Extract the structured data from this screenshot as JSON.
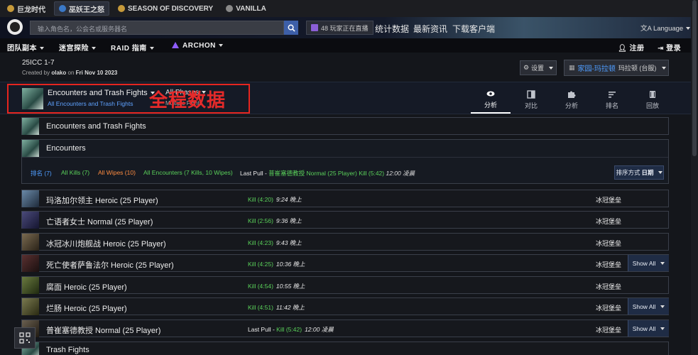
{
  "gamebar": {
    "items": [
      {
        "label": "巨龙时代",
        "active": false
      },
      {
        "label": "巫妖王之怒",
        "active": true
      },
      {
        "label": "SEASON OF DISCOVERY",
        "active": false
      },
      {
        "label": "VANILLA",
        "active": false
      }
    ]
  },
  "header": {
    "search_placeholder": "输入角色名，公会名或服务器名",
    "live_label": "48 玩家正在直播",
    "links": [
      "统计数据",
      "最新资讯",
      "下载客户端"
    ],
    "language_label": "Language"
  },
  "nav": {
    "items": [
      "团队副本",
      "迷宫探险",
      "RAID 指南",
      "ARCHON"
    ],
    "register": "注册",
    "login": "登录"
  },
  "report": {
    "title": "25ICC 1-7",
    "created_by_prefix": "Created by",
    "author": "olako",
    "on": "on",
    "date": "Fri Nov 10 2023"
  },
  "controls": {
    "settings_label": "设置",
    "guild_name": "家园-玛拉顿",
    "guild_server": "玛拉顿 (台服)"
  },
  "toolbar": {
    "fight_title": "Encounters and Trash Fights",
    "fight_sub": "All Encounters and Trash Fights",
    "phase_title": "All Phases",
    "phase_sub": "Multiple Fights",
    "annotation": "全程数据",
    "tabs": [
      {
        "label": "分析",
        "icon": "eye-icon",
        "active": true
      },
      {
        "label": "对比",
        "icon": "compare-icon",
        "active": false
      },
      {
        "label": "分析",
        "icon": "puzzle-icon",
        "active": false
      },
      {
        "label": "排名",
        "icon": "ranking-icon",
        "active": false
      },
      {
        "label": "回放",
        "icon": "replay-icon",
        "active": false
      }
    ]
  },
  "content": {
    "all_fights_label": "Encounters and Trash Fights",
    "encounters_label": "Encounters",
    "filters": {
      "rank": "排名 (7)",
      "all_kills": "All Kills (7)",
      "all_wipes": "All Wipes (10)",
      "all_encounters": "All Encounters (7 Kills, 10 Wipes)",
      "last_pull_prefix": "Last Pull - ",
      "last_pull_text": "普崔塞德教授 Normal (25 Player) Kill (5:42)",
      "last_pull_time": "12:00 凌晨"
    },
    "sort_label": "排序方式",
    "sort_value": "日期",
    "fights": [
      {
        "name": "玛洛加尔领主 Heroic (25 Player)",
        "prefix": "",
        "kill": "Kill (4:20)",
        "time": "9:24 晚上",
        "zone": "冰冠堡垒",
        "show_all": false
      },
      {
        "name": "亡语者女士 Normal (25 Player)",
        "prefix": "",
        "kill": "Kill (2:56)",
        "time": "9:36 晚上",
        "zone": "冰冠堡垒",
        "show_all": false
      },
      {
        "name": "冰冠冰川炮舰战 Heroic (25 Player)",
        "prefix": "",
        "kill": "Kill (4:23)",
        "time": "9:43 晚上",
        "zone": "冰冠堡垒",
        "show_all": false
      },
      {
        "name": "死亡使者萨鲁法尔 Heroic (25 Player)",
        "prefix": "",
        "kill": "Kill (4:25)",
        "time": "10:36 晚上",
        "zone": "冰冠堡垒",
        "show_all": true
      },
      {
        "name": "腐面 Heroic (25 Player)",
        "prefix": "",
        "kill": "Kill (4:54)",
        "time": "10:55 晚上",
        "zone": "冰冠堡垒",
        "show_all": false
      },
      {
        "name": "烂肠 Heroic (25 Player)",
        "prefix": "",
        "kill": "Kill (4:51)",
        "time": "11:42 晚上",
        "zone": "冰冠堡垒",
        "show_all": true
      },
      {
        "name": "普崔塞德教授 Normal (25 Player)",
        "prefix": "Last Pull - ",
        "kill": "Kill (5:42)",
        "time": "12:00 凌晨",
        "zone": "冰冠堡垒",
        "show_all": true
      }
    ],
    "show_all_label": "Show All",
    "trash_label": "Trash Fights"
  },
  "colors": {
    "kill_green": "#5ad15a",
    "wipe_orange": "#ff8c40",
    "link_blue": "#4f9dff",
    "annotation_red": "#e5251f"
  }
}
